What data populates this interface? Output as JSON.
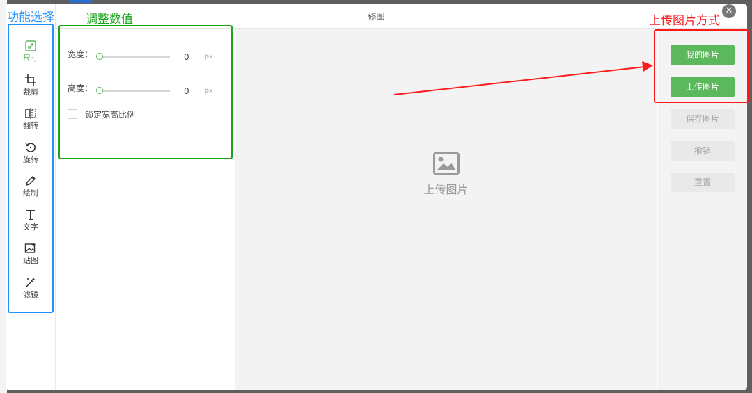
{
  "dialog": {
    "title": "修图",
    "close_icon": "close-icon"
  },
  "tools": [
    {
      "icon": "resize-icon",
      "label": "尺寸",
      "active": true
    },
    {
      "icon": "crop-icon",
      "label": "裁剪",
      "active": false
    },
    {
      "icon": "flip-icon",
      "label": "翻转",
      "active": false
    },
    {
      "icon": "rotate-icon",
      "label": "旋转",
      "active": false
    },
    {
      "icon": "pencil-icon",
      "label": "绘制",
      "active": false
    },
    {
      "icon": "text-icon",
      "label": "文字",
      "active": false
    },
    {
      "icon": "sticker-icon",
      "label": "贴图",
      "active": false
    },
    {
      "icon": "filter-icon",
      "label": "滤镜",
      "active": false
    }
  ],
  "panel": {
    "width_label": "宽度：",
    "width_value": "0",
    "height_label": "高度：",
    "height_value": "0",
    "unit": "px",
    "lock_label": "锁定宽高比例",
    "lock_checked": false
  },
  "canvas": {
    "placeholder_icon": "image-icon",
    "placeholder_text": "上传图片"
  },
  "actions": {
    "my_images": "我的图片",
    "upload": "上传图片",
    "save": "保存图片",
    "undo": "撤销",
    "reset": "重置"
  },
  "annotations": {
    "tools_label": "功能选择",
    "panel_label": "调整数值",
    "upload_label": "上传图片方式",
    "colors": {
      "blue": "#1e90ff",
      "green": "#1aa51a",
      "red": "#ff1a1a"
    }
  },
  "colors": {
    "accent": "#5cb85c"
  }
}
